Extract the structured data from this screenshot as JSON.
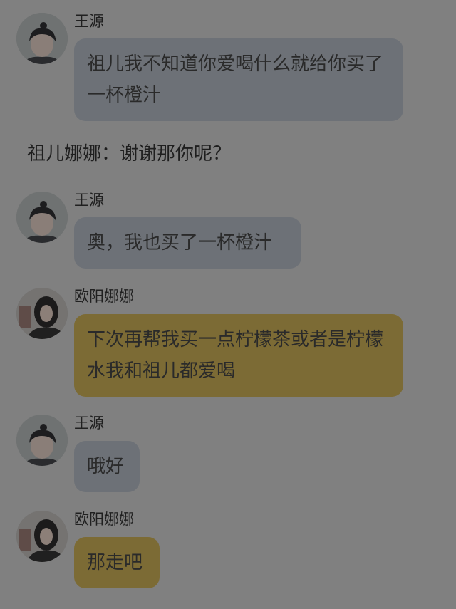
{
  "messages": [
    {
      "sender": "王源",
      "text": "祖儿我不知道你爱喝什么就给你买了一杯橙汁",
      "avatar": "boy-avatar",
      "color": "#6d7177"
    },
    {
      "narration": "祖儿娜娜：谢谢那你呢？"
    },
    {
      "sender": "王源",
      "text": "奥，我也买了一杯橙汁",
      "avatar": "boy-avatar",
      "color": "#6d7177"
    },
    {
      "sender": "欧阳娜娜",
      "text": "下次再帮我买一点柠檬茶或者是柠檬水我和祖儿都爱喝",
      "avatar": "girl-avatar",
      "color": "#7c6b35"
    },
    {
      "sender": "王源",
      "text": "哦好",
      "avatar": "boy-avatar",
      "color": "#6d7177"
    },
    {
      "sender": "欧阳娜娜",
      "text": "那走吧",
      "avatar": "girl-avatar",
      "color": "#7c6b35"
    }
  ]
}
